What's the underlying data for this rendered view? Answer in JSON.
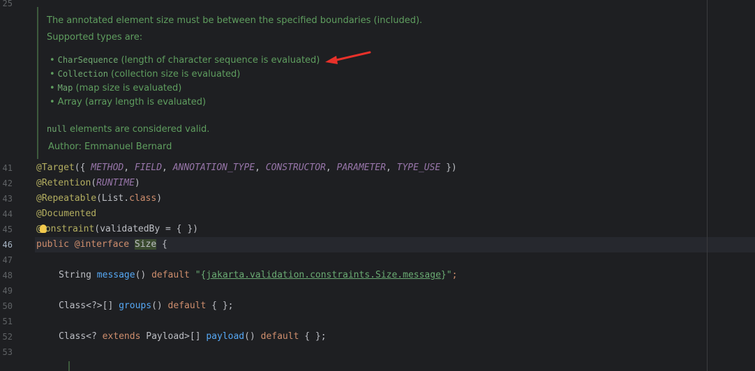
{
  "gutter": {
    "top_number": "25",
    "numbers": [
      "41",
      "42",
      "43",
      "44",
      "45",
      "46",
      "47",
      "48",
      "49",
      "50",
      "51",
      "52",
      "53"
    ],
    "active_number": "46"
  },
  "javadoc": {
    "intro": "The annotated element size must be between the specified boundaries (included).",
    "supported": "Supported types are:",
    "items": [
      {
        "code": "CharSequence",
        "text": " (length of character sequence is evaluated)"
      },
      {
        "code": "Collection",
        "text": " (collection size is evaluated)"
      },
      {
        "code": "Map",
        "text": " (map size is evaluated)"
      },
      {
        "code": "",
        "text": "Array (array length is evaluated)"
      }
    ],
    "null_code": "null",
    "null_text": " elements are considered valid.",
    "author": "Author: Emmanuel Bernard"
  },
  "code": {
    "l41": {
      "ann": "@Target",
      "open": "({ ",
      "a": "METHOD",
      "b": "FIELD",
      "c": "ANNOTATION_TYPE",
      "d": "CONSTRUCTOR",
      "e": "PARAMETER",
      "f": "TYPE_USE",
      "close": " })",
      "sep": ", "
    },
    "l42": {
      "ann": "@Retention",
      "open": "(",
      "val": "RUNTIME",
      "close": ")"
    },
    "l43": {
      "ann": "@Repeatable",
      "open": "(",
      "cls": "List",
      "dot": ".",
      "kw": "class",
      "close": ")"
    },
    "l44": {
      "ann": "@Documented"
    },
    "l45": {
      "at": "@",
      "rest": "onstraint",
      "args": "(validatedBy = { })"
    },
    "l46": {
      "kw1": "public",
      "kw2": " @interface ",
      "name": "Size",
      "brace": " {"
    },
    "l48": {
      "type": "String ",
      "fn": "message",
      "paren": "() ",
      "kw": "default",
      "sp": " ",
      "q1": "\"{",
      "link": "jakarta.validation.constraints.Size.message",
      "q2": "}\"",
      "semi": ";"
    },
    "l50": {
      "type": "Class<?>[] ",
      "fn": "groups",
      "paren": "() ",
      "kw": "default",
      "rest": " { };"
    },
    "l52": {
      "type": "Class<? ",
      "kw1": "extends",
      "type2": " Payload>[] ",
      "fn": "payload",
      "paren": "() ",
      "kw": "default",
      "rest": " { };"
    }
  },
  "colors": {
    "background": "#1e1f22",
    "annotation": "#b3ae60",
    "keyword": "#cf8e6d",
    "javadoc": "#5f9e5f",
    "arrow": "#e8312a"
  },
  "icons": [
    "intention-bulb-icon",
    "red-arrow-annotation"
  ]
}
